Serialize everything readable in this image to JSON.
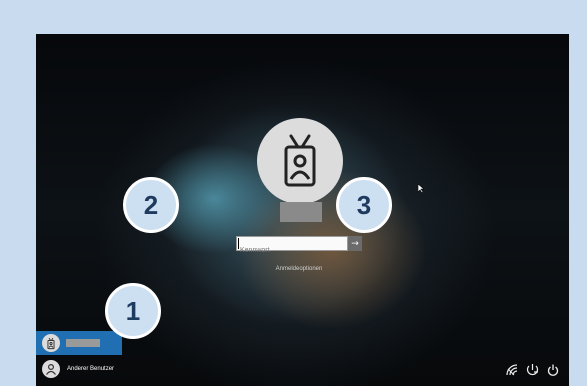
{
  "login": {
    "password_placeholder": "Kennwort",
    "submit_symbol": "→",
    "signin_options": "Anmeldeoptionen"
  },
  "users": [
    {
      "label": "",
      "selected": true,
      "icon": "badge-icon"
    },
    {
      "label": "Anderer Benutzer",
      "selected": false,
      "icon": "person-icon"
    }
  ],
  "callouts": {
    "one": "1",
    "two": "2",
    "three": "3"
  },
  "tray": {
    "icons": [
      "network-icon",
      "ease-of-access-icon",
      "power-icon"
    ]
  },
  "colors": {
    "selected_user_bg": "#1f6fb2",
    "callout_fill": "#cde0f1",
    "frame": "#c9dcef"
  }
}
